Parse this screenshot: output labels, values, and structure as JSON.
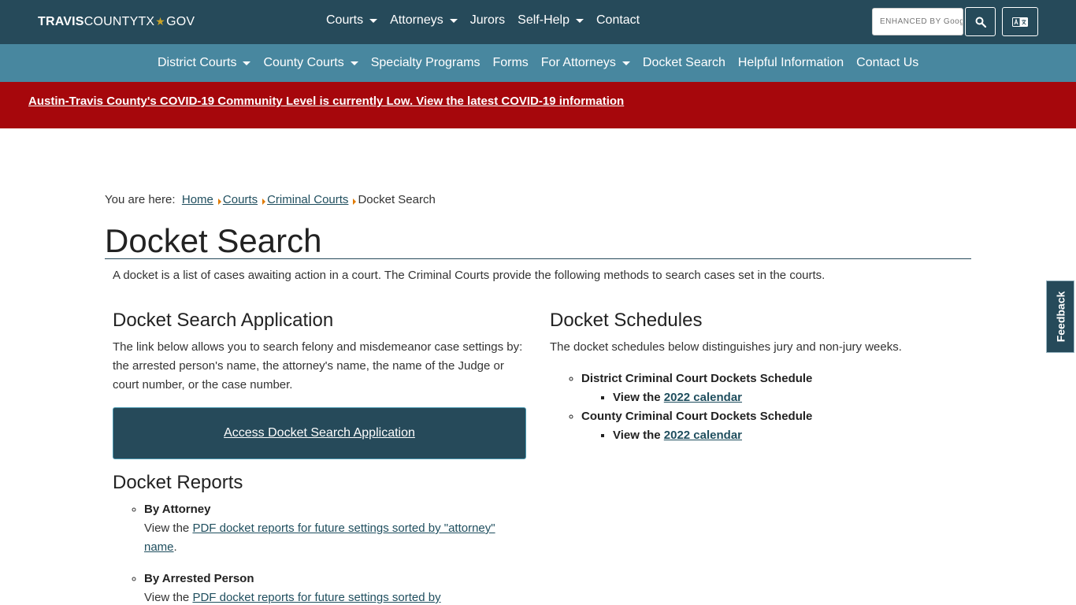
{
  "header": {
    "logo": {
      "part1": "TRAVIS",
      "part2": "COUNTYTX",
      "star": "★",
      "part3": "GOV"
    },
    "nav": [
      {
        "label": "Courts",
        "dropdown": true
      },
      {
        "label": "Attorneys",
        "dropdown": true
      },
      {
        "label": "Jurors",
        "dropdown": false
      },
      {
        "label": "Self-Help",
        "dropdown": true
      },
      {
        "label": "Contact",
        "dropdown": false
      }
    ],
    "search": {
      "placeholder": "ENHANCED BY Google",
      "icon": "search-icon"
    },
    "translate_icon": "translate-icon"
  },
  "subnav": [
    {
      "label": "District Courts",
      "dropdown": true
    },
    {
      "label": "County Courts",
      "dropdown": true
    },
    {
      "label": "Specialty Programs",
      "dropdown": false
    },
    {
      "label": "Forms",
      "dropdown": false
    },
    {
      "label": "For Attorneys",
      "dropdown": true
    },
    {
      "label": "Docket Search",
      "dropdown": false
    },
    {
      "label": "Helpful Information",
      "dropdown": false
    },
    {
      "label": "Contact Us",
      "dropdown": false
    }
  ],
  "alert": {
    "text": "Austin-Travis County's COVID-19 Community Level is currently Low. View the latest COVID-19 information"
  },
  "breadcrumb": {
    "prefix": "You are here:",
    "links": [
      "Home",
      "Courts",
      "Criminal Courts"
    ],
    "current": "Docket Search"
  },
  "page": {
    "title": "Docket Search",
    "intro": "A docket is a list of cases awaiting action in a court. The Criminal Courts provide the following methods to search cases set in the courts."
  },
  "left": {
    "app_title": "Docket Search Application",
    "app_desc": "The link below allows you to search felony and misdemeanor case settings by: the arrested person's name, the attorney's name, the name of the Judge or court number, or the case number.",
    "access_button": "Access Docket Search Application",
    "reports_title": "Docket Reports",
    "reports": [
      {
        "title": "By Attorney",
        "prefix": "View the",
        "link": "PDF docket reports for future settings sorted by \"attorney\" name",
        "suffix": "."
      },
      {
        "title": "By Arrested Person",
        "prefix": "View the",
        "link": "PDF docket reports for future settings sorted by",
        "suffix": ""
      }
    ]
  },
  "right": {
    "sched_title": "Docket Schedules",
    "sched_desc": "The docket schedules below distinguishes jury and non-jury weeks.",
    "schedules": [
      {
        "title": "District Criminal Court Dockets Schedule",
        "prefix": "View the",
        "link": "2022 calendar"
      },
      {
        "title": "County Criminal Court Dockets Schedule",
        "prefix": "View the",
        "link": "2022 calendar"
      }
    ]
  },
  "feedback": {
    "label": "Feedback"
  },
  "colors": {
    "header": "#264a5a",
    "subnav": "#48879f",
    "alert": "#a6070c",
    "accent": "#e07b00"
  }
}
